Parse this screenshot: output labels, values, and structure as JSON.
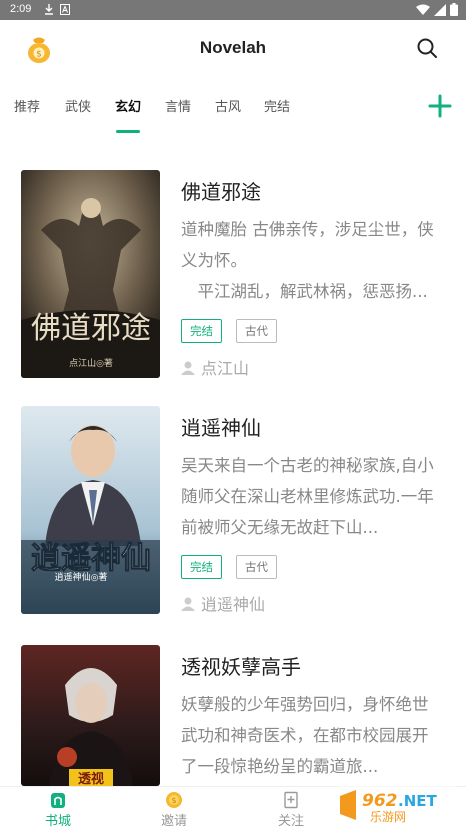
{
  "status_bar": {
    "time": "2:09",
    "icons": [
      "download-icon",
      "a-notification-icon",
      "wifi-icon",
      "signal-icon",
      "battery-icon"
    ]
  },
  "header": {
    "title": "Novelah",
    "logo_icon": "coin-bag-icon",
    "search_icon": "search-icon"
  },
  "tabs": [
    {
      "label": "推荐",
      "active": false
    },
    {
      "label": "武侠",
      "active": false
    },
    {
      "label": "玄幻",
      "active": true
    },
    {
      "label": "言情",
      "active": false
    },
    {
      "label": "古风",
      "active": false
    },
    {
      "label": "完结",
      "active": false
    }
  ],
  "add_icon": "plus-icon",
  "books": [
    {
      "title": "佛道邪途",
      "description": "道种魔胎 古佛亲传，涉足尘世，侠义为怀。\n　平江湖乱，解武林祸，惩恶扬...",
      "status": "完结",
      "genre": "古代",
      "author": "点江山",
      "cover_text": "佛道邪途",
      "cover_author": "点江山◎著"
    },
    {
      "title": "逍遥神仙",
      "description": "吴天来自一个古老的神秘家族,自小随师父在深山老林里修炼武功.一年前被师父无缘无故赶下山...",
      "status": "完结",
      "genre": "古代",
      "author": "逍遥神仙",
      "cover_text": "逍遥神仙",
      "cover_author": "逍遥神仙◎著"
    },
    {
      "title": "透视妖孽高手",
      "description": "妖孽般的少年强势回归，身怀绝世武功和神奇医术，在都市校园展开了一段惊艳纷呈的霸道旅...",
      "status": "",
      "genre": "",
      "author": "",
      "cover_text": "透视"
    }
  ],
  "bottom_nav": [
    {
      "label": "书城",
      "icon": "bookstore-icon",
      "active": true
    },
    {
      "label": "邀请",
      "icon": "coin-icon",
      "active": false
    },
    {
      "label": "关注",
      "icon": "bookmark-icon",
      "active": false
    }
  ],
  "watermark": "962.NET 乐游网",
  "colors": {
    "accent": "#12b07e",
    "status_bar": "#777777",
    "muted_text": "#888888"
  }
}
